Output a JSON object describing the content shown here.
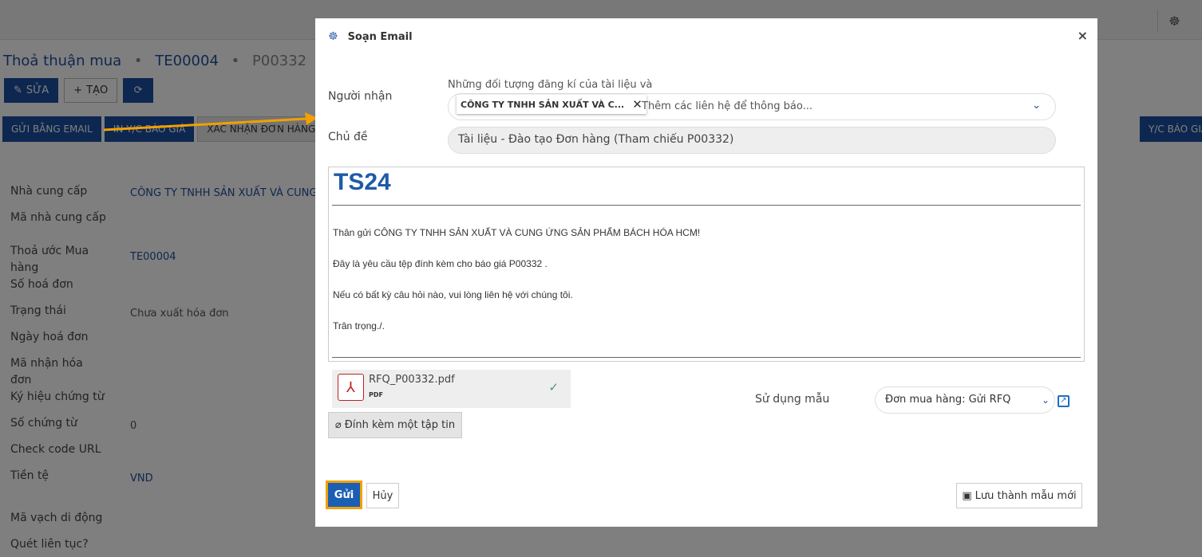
{
  "topbar": {
    "bug_icon": "bug-icon"
  },
  "breadcrumb": {
    "item1": "Thoả thuận mua",
    "sep": "•",
    "item2": "TE00004",
    "item3": "P00332"
  },
  "toolbar": {
    "edit": "SỬA",
    "create": "TẠO",
    "refresh_icon": "refresh-icon"
  },
  "actions": {
    "send_email": "GỬI BẰNG EMAIL",
    "print_rfq": "IN Y/C BÁO GIÁ",
    "confirm_order": "XÁC NHẬN ĐƠN HÀNG",
    "rfq_right": "Y/C BÁO GIÁ"
  },
  "form": {
    "supplier_label": "Nhà cung cấp",
    "supplier_value": "CÔNG TY TNHH SẢN XUẤT VÀ CUNG ỨNG",
    "supplier_code_label": "Mã nhà cung cấp",
    "agreement_label": "Thoả ước Mua hàng",
    "agreement_value": "TE00004",
    "invoice_no_label": "Số hoá đơn",
    "status_label": "Trạng thái",
    "status_value": "Chưa xuất hóa đơn",
    "invoice_date_label": "Ngày hoá đơn",
    "invoice_code_label": "Mã nhận hóa đơn",
    "doc_symbol_label": "Ký hiệu chứng từ",
    "doc_no_label": "Số chứng từ",
    "doc_no_value": "0",
    "check_url_label": "Check code URL",
    "currency_label": "Tiền tệ",
    "currency_value": "VND",
    "mobile_barcode_label": "Mã vạch di động",
    "continuous_scan_label": "Quét liên tục?"
  },
  "modal": {
    "title": "Soạn Email",
    "close": "×",
    "recipients_label": "Người nhận",
    "recipients_hint": "Những đối tượng đăng kí của tài liệu và",
    "recipient_tag": "CÔNG TY TNHH SẢN XUẤT VÀ C...",
    "recipient_remove": "✕",
    "recipients_placeholder": "Thêm các liên hệ để thông báo...",
    "subject_label": "Chủ đề",
    "subject_value": "Tài liệu - Đào tạo Đơn hàng (Tham chiếu P00332)",
    "logo": "TS24",
    "body": [
      "Thân gửi CÔNG TY TNHH SẢN XUẤT VÀ CUNG ỨNG SẢN PHẨM BÁCH HÓA HCM!",
      "Đây là yêu cầu tệp đính kèm cho báo giá P00332 .",
      "Nếu có bất kỳ câu hỏi nào, vui lòng liên hệ với chúng tôi.",
      "Trân trọng./."
    ],
    "attachment_name": "RFQ_P00332.pdf",
    "attachment_type": "PDF",
    "attach_button": "Đính kèm một tập tin",
    "template_label": "Sử dụng mẫu",
    "template_value": "Đơn mua hàng: Gửi RFQ",
    "send": "Gửi",
    "cancel": "Hủy",
    "save_template": "Lưu thành mẫu mới"
  },
  "colors": {
    "primary": "#1a4fa0",
    "highlight": "#f2a000"
  }
}
